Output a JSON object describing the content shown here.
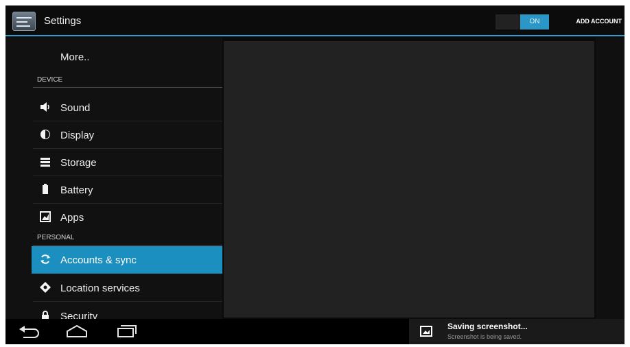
{
  "action_bar": {
    "title": "Settings",
    "wifi_toggle_label": "ON",
    "add_account_label": "ADD ACCOUNT",
    "app_icon": "settings-icon"
  },
  "settings_list": {
    "more_label": "More..",
    "device_header": "DEVICE",
    "device_items": [
      {
        "label": "Sound",
        "icon": "speaker-icon"
      },
      {
        "label": "Display",
        "icon": "brightness-icon"
      },
      {
        "label": "Storage",
        "icon": "storage-icon"
      },
      {
        "label": "Battery",
        "icon": "battery-icon"
      },
      {
        "label": "Apps",
        "icon": "apps-icon"
      }
    ],
    "personal_header": "PERSONAL",
    "personal_items": [
      {
        "label": "Accounts & sync",
        "icon": "sync-icon",
        "selected": true
      },
      {
        "label": "Location services",
        "icon": "location-icon"
      },
      {
        "label": "Security",
        "icon": "lock-icon"
      }
    ]
  },
  "navigation": {
    "back": "back-icon",
    "home": "home-icon",
    "recents": "recent-apps-icon"
  },
  "notification": {
    "title": "Saving screenshot...",
    "subtitle": "Screenshot is being saved.",
    "icon": "image-icon"
  },
  "colors": {
    "accent": "#1b8fbf",
    "background": "#111111",
    "content": "#222222"
  }
}
